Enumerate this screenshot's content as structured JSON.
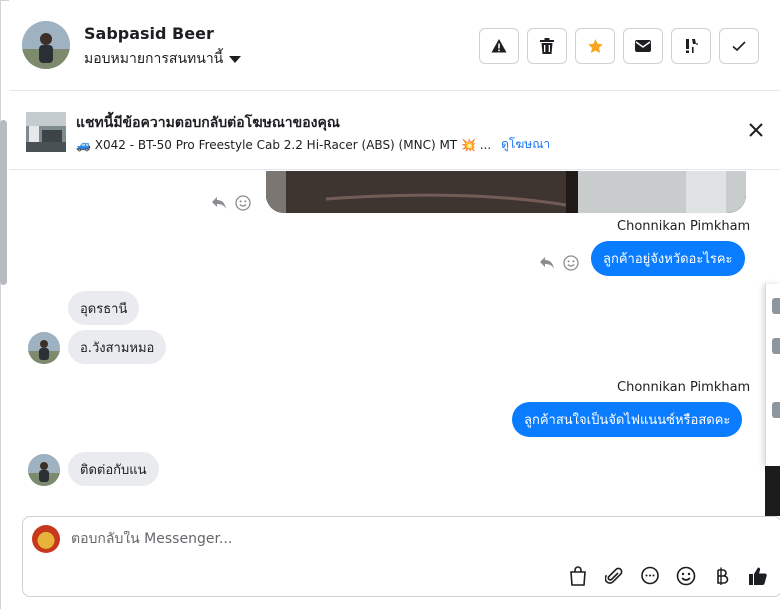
{
  "header": {
    "contact_name": "Sabpasid Beer",
    "assign_label": "มอบหมายการสนทนานี้",
    "toolbar": [
      {
        "name": "report-spam-button",
        "icon": "warning-icon"
      },
      {
        "name": "delete-button",
        "icon": "trash-icon"
      },
      {
        "name": "star-button",
        "icon": "star-icon"
      },
      {
        "name": "mark-unread-button",
        "icon": "envelope-icon"
      },
      {
        "name": "follow-up-button",
        "icon": "exclamation-icon"
      },
      {
        "name": "mark-done-button",
        "icon": "check-icon"
      }
    ]
  },
  "ad_banner": {
    "title": "แชทนี้มีข้อความตอบกลับต่อโฆษณาของคุณ",
    "description": "🚙 X042 - BT-50 Pro Freestyle Cab 2.2 Hi-Racer (ABS) (MNC) MT 💥 ...",
    "link_label": "ดูโฆษณา"
  },
  "messages": {
    "sender_1": "Chonnikan Pimkham",
    "outgoing_1": "ลูกค้าอยู่จังหวัดอะไรคะ",
    "incoming_1": "อุดรธานี",
    "incoming_2": "อ.วังสามหมอ",
    "sender_2": "Chonnikan Pimkham",
    "outgoing_2": "ลูกค้าสนใจเป็นจัดไฟแนนซ์หรือสดคะ",
    "incoming_3": "ติดต่อกับแน"
  },
  "composer": {
    "placeholder": "ตอบกลับใน Messenger...",
    "tools": [
      "shopping-bag-icon",
      "paperclip-icon",
      "speech-bubble-icon",
      "emoji-icon",
      "baht-icon",
      "thumbs-up-icon"
    ]
  },
  "colors": {
    "accent": "#0a7cff",
    "incoming_bubble": "#e9ebee",
    "star": "#f5a623"
  }
}
